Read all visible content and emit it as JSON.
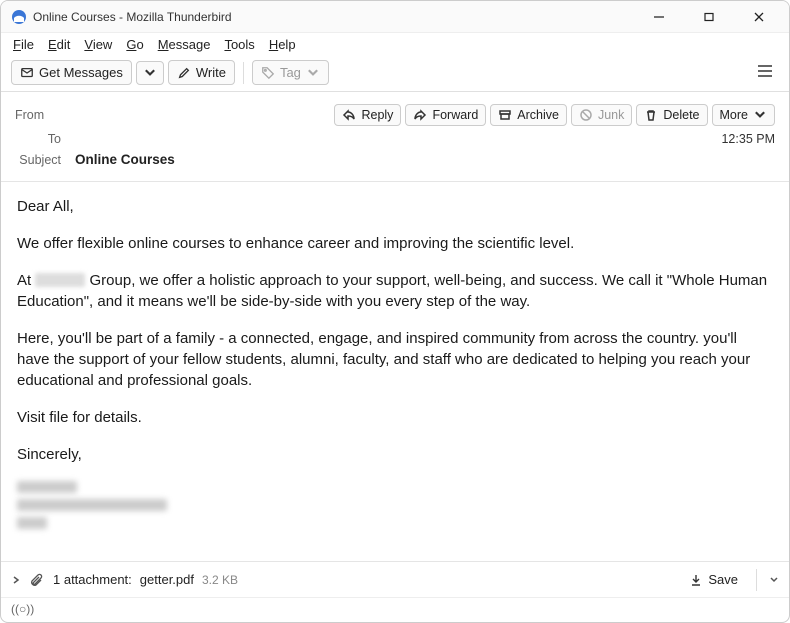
{
  "window": {
    "title": "Online Courses - Mozilla Thunderbird"
  },
  "menu": {
    "file": "File",
    "edit": "Edit",
    "view": "View",
    "go": "Go",
    "message": "Message",
    "tools": "Tools",
    "help": "Help"
  },
  "toolbar": {
    "getmessages": "Get Messages",
    "write": "Write",
    "tag": "Tag"
  },
  "actions": {
    "reply": "Reply",
    "forward": "Forward",
    "archive": "Archive",
    "junk": "Junk",
    "delete": "Delete",
    "more": "More"
  },
  "header": {
    "from_label": "From",
    "to_label": "To",
    "subject_label": "Subject",
    "subject": "Online Courses",
    "time": "12:35 PM"
  },
  "body": {
    "p1": "Dear All,",
    "p2": "We offer flexible online courses to enhance career and improving the scientific level.",
    "p3a": "At ",
    "p3b": " Group, we offer a holistic approach to your support, well-being, and success. We call it \"Whole Human Education\", and it means we'll be side-by-side with you every step of the way.",
    "p4": "Here, you'll be part of a family - a connected, engage, and inspired community from across the country. you'll have the support of your fellow students, alumni, faculty, and staff who are dedicated to helping you reach your educational and professional goals.",
    "p5": "Visit file for details.",
    "p6": "Sincerely,"
  },
  "attachment": {
    "label": "1 attachment:",
    "name": "getter.pdf",
    "size": "3.2 KB",
    "save": "Save"
  },
  "status": {
    "indicator": "((○))"
  }
}
